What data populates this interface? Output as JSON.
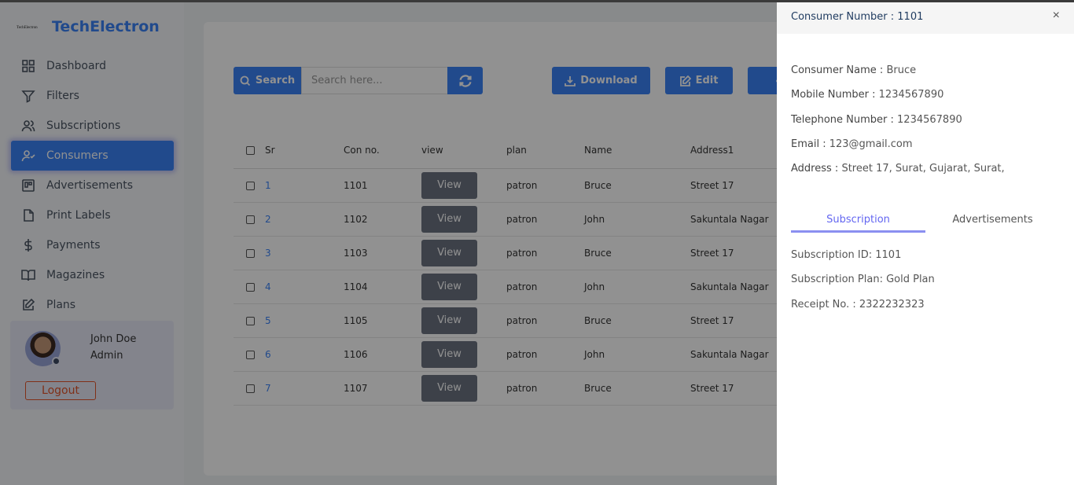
{
  "app": {
    "logo_text": "TechElectron",
    "brand": "TechElectron"
  },
  "sidebar": {
    "items": [
      {
        "label": "Dashboard",
        "icon": "grid-icon"
      },
      {
        "label": "Filters",
        "icon": "filter-icon"
      },
      {
        "label": "Subscriptions",
        "icon": "users-icon"
      },
      {
        "label": "Consumers",
        "icon": "user-check-icon",
        "active": true
      },
      {
        "label": "Advertisements",
        "icon": "board-icon"
      },
      {
        "label": "Print Labels",
        "icon": "file-icon"
      },
      {
        "label": "Payments",
        "icon": "dollar-icon"
      },
      {
        "label": "Magazines",
        "icon": "book-icon"
      },
      {
        "label": "Plans",
        "icon": "edit-icon"
      }
    ],
    "profile": {
      "name": "John Doe",
      "role": "Admin",
      "logout": "Logout"
    }
  },
  "toolbar": {
    "search_label": "Search",
    "search_placeholder": "Search here...",
    "download": "Download",
    "edit": "Edit"
  },
  "table": {
    "headers": [
      "Sr",
      "Con no.",
      "view",
      "plan",
      "Name",
      "Address1"
    ],
    "view_label": "View",
    "rows": [
      [
        "1",
        "1101",
        "patron",
        "Bruce",
        "Street 17"
      ],
      [
        "2",
        "1102",
        "patron",
        "John",
        "Sakuntala Nagar"
      ],
      [
        "3",
        "1103",
        "patron",
        "Bruce",
        "Street 17"
      ],
      [
        "4",
        "1104",
        "patron",
        "John",
        "Sakuntala Nagar"
      ],
      [
        "5",
        "1105",
        "patron",
        "Bruce",
        "Street 17"
      ],
      [
        "6",
        "1106",
        "patron",
        "John",
        "Sakuntala Nagar"
      ],
      [
        "7",
        "1107",
        "patron",
        "Bruce",
        "Street 17"
      ]
    ]
  },
  "drawer": {
    "title": "Consumer Number : 1101",
    "close": "×",
    "fields": [
      {
        "label": "Consumer Name :",
        "value": "Bruce"
      },
      {
        "label": "Mobile Number :",
        "value": "1234567890"
      },
      {
        "label": "Telephone Number :",
        "value": "1234567890"
      },
      {
        "label": "Email :",
        "value": "123@gmail.com"
      },
      {
        "label": "Address :",
        "value": "Street 17, Surat, Gujarat, Surat,"
      }
    ],
    "tabs": [
      "Subscription",
      "Advertisements"
    ],
    "subscription": [
      "Subscription ID: 1101",
      "Subscription Plan: Gold Plan",
      "Receipt No. : 2322232323"
    ]
  },
  "colors": {
    "accent": "#3b82f6",
    "tab_active": "#6366f1",
    "logout": "#e2552b"
  }
}
